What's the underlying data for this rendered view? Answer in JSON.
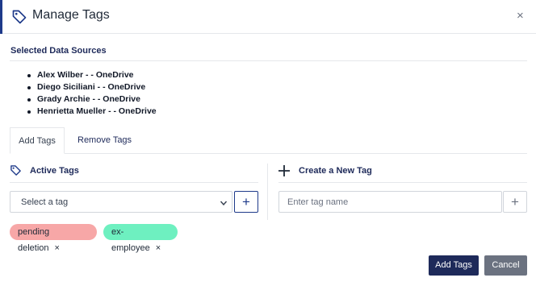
{
  "dialog": {
    "title": "Manage Tags",
    "close": "×"
  },
  "selected_sources": {
    "title": "Selected Data Sources",
    "items": [
      "Alex Wilber - - OneDrive",
      "Diego Siciliani - - OneDrive",
      "Grady Archie - - OneDrive",
      "Henrietta Mueller - - OneDrive"
    ]
  },
  "tabs": {
    "add": "Add Tags",
    "remove": "Remove Tags"
  },
  "active_tags": {
    "title": "Active Tags",
    "select_value": "Select a tag",
    "add_symbol": "+"
  },
  "new_tag": {
    "title": "Create a New Tag",
    "placeholder": "Enter tag name",
    "add_symbol": "+"
  },
  "chips": [
    {
      "label": "pending deletion",
      "remove": "×",
      "color": "#f7a7a7"
    },
    {
      "label": "ex-employee",
      "remove": "×",
      "color": "#6ef0c0"
    }
  ],
  "footer": {
    "add_label": "Add Tags",
    "cancel_label": "Cancel"
  },
  "colors": {
    "accent": "#1e3a8a",
    "primary_button": "#1e2a5a",
    "cancel_button": "#6b7280"
  }
}
